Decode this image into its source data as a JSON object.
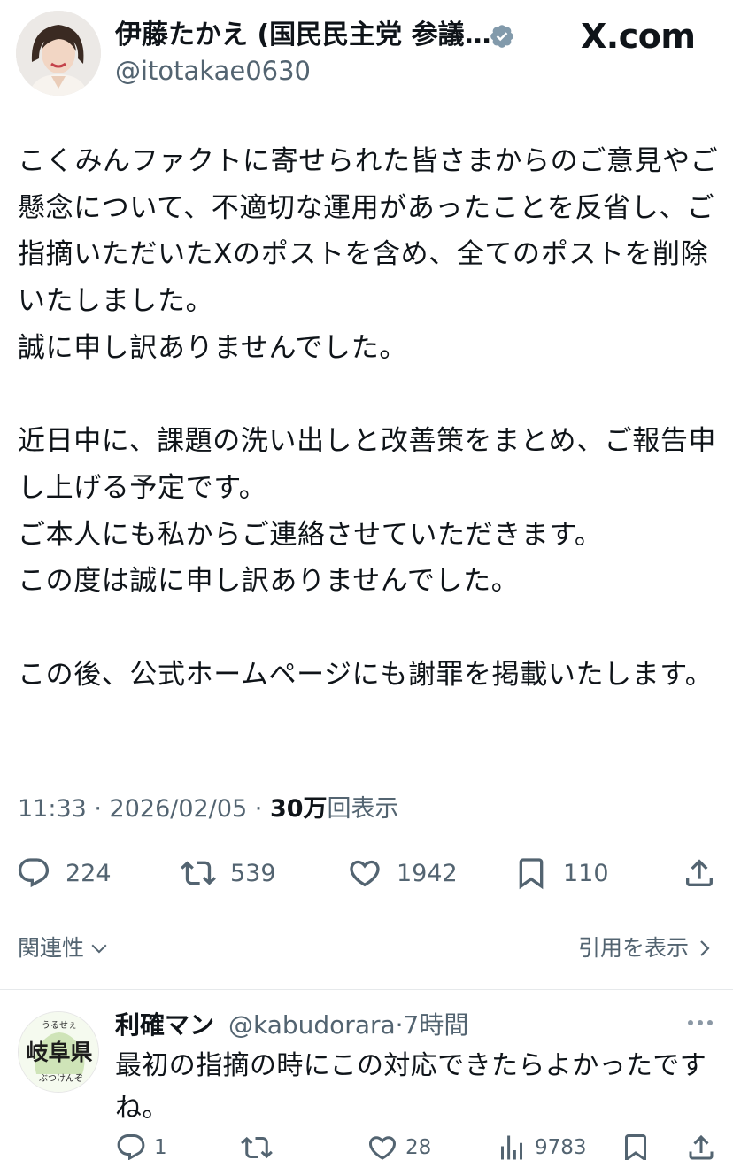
{
  "author": {
    "name": "伊藤たかえ (国民民主党 参議…",
    "handle": "@itotakae0630"
  },
  "brand": "X.com",
  "post": {
    "text": "こくみんファクトに寄せられた皆さまからのご意見やご懸念について、不適切な運用があったことを反省し、ご指摘いただいたXのポストを含め、全てのポストを削除いたしました。\n誠に申し訳ありませんでした。\n\n近日中に、課題の洗い出しと改善策をまとめ、ご報告申し上げる予定です。\nご本人にも私からご連絡させていただきます。\nこの度は誠に申し訳ありませんでした。\n\nこの後、公式ホームページにも謝罪を掲載いたします。",
    "time": "11:33 · 2026/02/05 · ",
    "views": "30万",
    "views_label": "回表示"
  },
  "actions": {
    "replies": "224",
    "reposts": "539",
    "likes": "1942",
    "bookmarks": "110"
  },
  "related_label": "関連性",
  "quotes_label": "引用を表示",
  "reply": {
    "avatar_text_top": "うるせぇ",
    "avatar_text_main": "岐阜県",
    "avatar_text_bottom": "ぶつけんぞ",
    "name": "利確マン",
    "handle": "@kabudorara·7時間",
    "text": "最初の指摘の時にこの対応できたらよかったですね。",
    "replies": "1",
    "likes": "28",
    "views": "9783"
  },
  "colors": {
    "text": "#0f1419",
    "muted": "#536471",
    "verified": "#829aab"
  }
}
